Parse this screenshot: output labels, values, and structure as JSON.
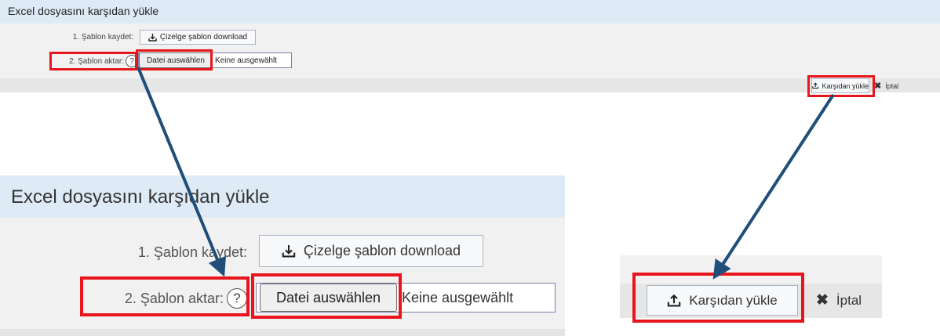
{
  "dialog": {
    "title": "Excel dosyasını karşıdan yükle",
    "step1_label": "1. Şablon kaydet:",
    "step1_button": "Çizelge şablon download",
    "step2_label": "2. Şablon aktar:",
    "help_glyph": "?",
    "file_button": "Datei auswählen",
    "file_status": "Keine ausgewählt",
    "upload_button": "Karşıdan yükle",
    "cancel_button": "İptal"
  },
  "icons": {
    "download": "download-icon",
    "upload": "upload-icon",
    "cancel": "close-icon",
    "help": "help-circle-icon"
  },
  "colors": {
    "title_bar": "#deebf7",
    "highlight": "#e8161c",
    "arrow": "#1f4e79"
  }
}
